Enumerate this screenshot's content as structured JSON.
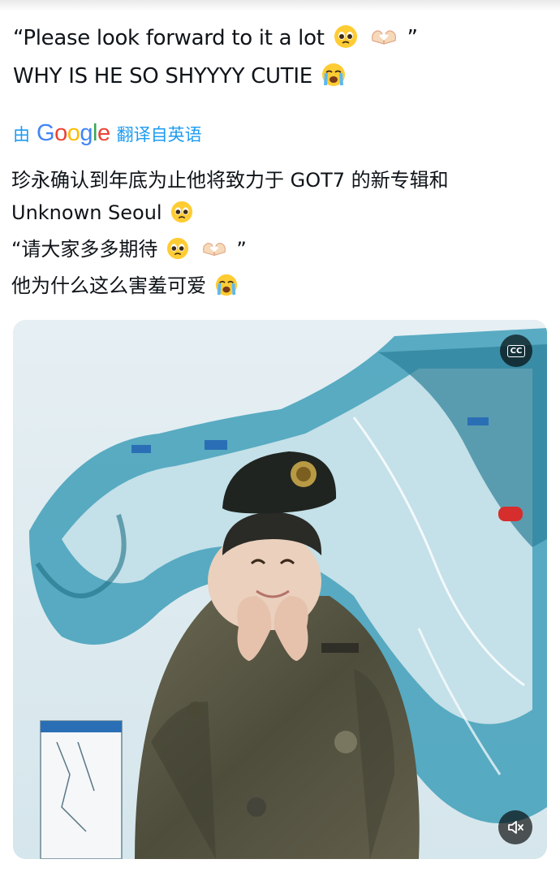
{
  "tweet": {
    "original_lines": [
      "“Please look forward to it a lot",
      "WHY IS HE SO SHYYYY CUTIE"
    ],
    "original_line1_close_quote": "”",
    "emoji": {
      "pleading": "pleading-face-emoji",
      "heart_hands": "heart-hands-emoji",
      "crying": "loudly-crying-face-emoji"
    }
  },
  "translation": {
    "prefix": "由",
    "brand": [
      "G",
      "o",
      "o",
      "g",
      "l",
      "e"
    ],
    "suffix": "翻译自英语",
    "lines": [
      "珍永确认到年底为止他将致力于 GOT7 的新专辑和",
      "Unknown Seoul",
      "“请大家多多期待",
      "他为什么这么害羞可爱"
    ],
    "line3_close_quote": " ”"
  },
  "media": {
    "cc_label": "CC",
    "icons": [
      "closed-captions-icon",
      "volume-muted-icon"
    ],
    "colors": {
      "map_water": "#2e8fa8",
      "map_snow": "#eef5f6",
      "uniform": "#5b5a48",
      "beret": "#1f2420"
    }
  }
}
